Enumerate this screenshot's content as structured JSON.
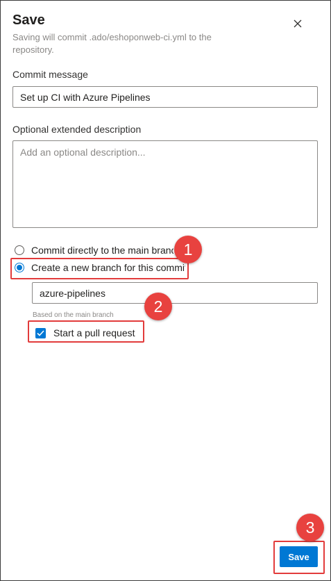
{
  "dialog": {
    "title": "Save",
    "subtitle": "Saving will commit .ado/eshoponweb-ci.yml to the repository.",
    "close_icon": "close-icon"
  },
  "commit": {
    "label": "Commit message",
    "value": "Set up CI with Azure Pipelines"
  },
  "description": {
    "label": "Optional extended description",
    "placeholder": "Add an optional description..."
  },
  "branch_options": [
    {
      "label": "Commit directly to the main branch",
      "selected": false
    },
    {
      "label": "Create a new branch for this commit",
      "selected": true
    }
  ],
  "new_branch": {
    "value": "azure-pipelines",
    "hint": "Based on the main branch"
  },
  "pull_request": {
    "label": "Start a pull request",
    "checked": true
  },
  "footer": {
    "save_label": "Save"
  },
  "annotations": {
    "badge_1": "1",
    "badge_2": "2",
    "badge_3": "3"
  },
  "colors": {
    "accent": "#0078d4",
    "annotation_red": "#e23b3b"
  }
}
